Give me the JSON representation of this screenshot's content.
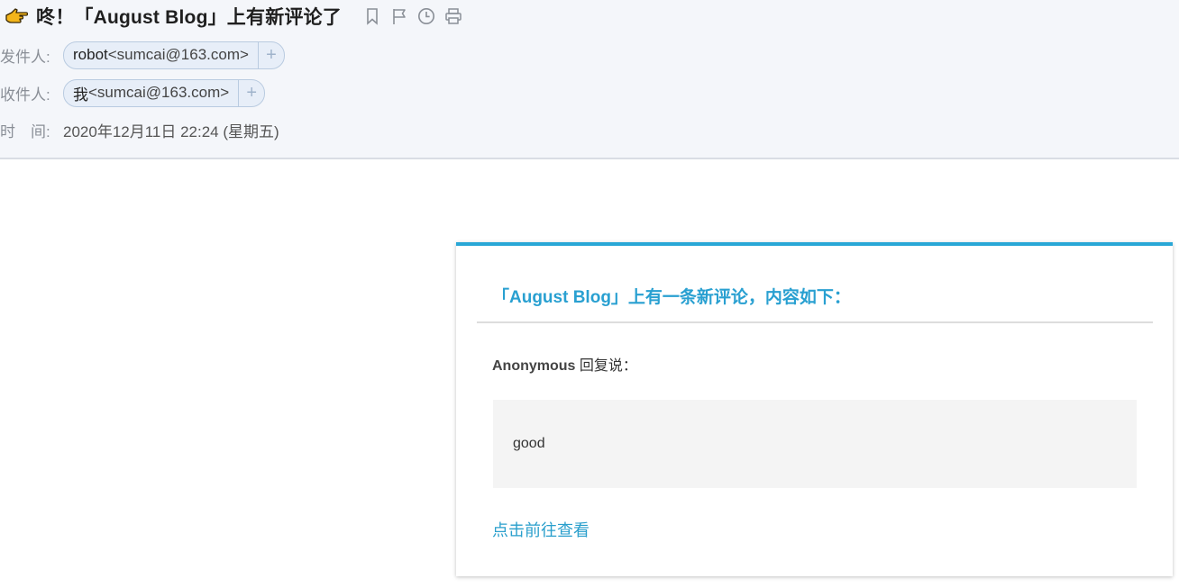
{
  "email": {
    "subject": "咚！「August Blog」上有新评论了",
    "sender": {
      "label": "发件人:",
      "name": "robot",
      "address": "<sumcai@163.com>",
      "add_label": "+"
    },
    "recipient": {
      "label": "收件人:",
      "name": "我",
      "address": "<sumcai@163.com>",
      "add_label": "+"
    },
    "time": {
      "label": "时　间:",
      "value": "2020年12月11日 22:24 (星期五)"
    },
    "icons": [
      "pointing-hand-icon",
      "bookmark-icon",
      "flag-icon",
      "clock-icon",
      "print-icon"
    ],
    "accent_color": "#29a7d6"
  },
  "body": {
    "title": "「August Blog」上有一条新评论，内容如下：",
    "author": "Anonymous",
    "reply_text": " 回复说：",
    "comment": "good",
    "link_label": "点击前往查看"
  }
}
